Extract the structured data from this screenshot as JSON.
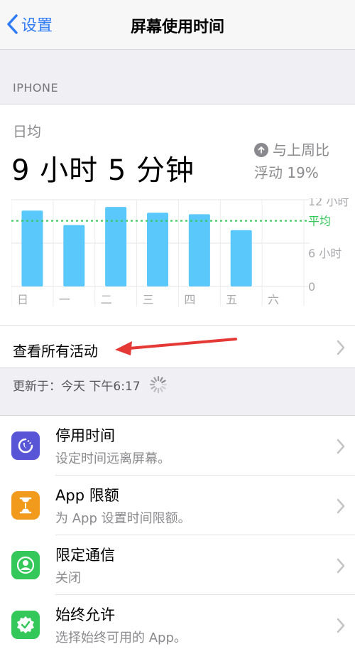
{
  "navbar": {
    "back_label": "设置",
    "title": "屏幕使用时间"
  },
  "section_header": "IPHONE",
  "summary": {
    "daily_label": "日均",
    "daily_value": "9 小时 5 分钟",
    "compare_line1": "与上周比",
    "compare_line2": "浮动 19%"
  },
  "chart_data": {
    "type": "bar",
    "categories": [
      "日",
      "一",
      "二",
      "三",
      "四",
      "五",
      "六"
    ],
    "values": [
      10.5,
      8.5,
      11,
      10.2,
      10,
      7.8,
      0
    ],
    "average": 9.08,
    "average_label": "平均",
    "y_ticks": [
      "12 小时",
      "6 小时",
      "0"
    ],
    "ylim": [
      0,
      12
    ],
    "bar_color": "#5ac8fa",
    "average_color": "#34c759"
  },
  "see_all_label": "查看所有活动",
  "updated": {
    "text": "更新于：今天 下午6:17"
  },
  "rows": [
    {
      "title": "停用时间",
      "subtitle": "设定时间远离屏幕。",
      "icon": "downtime-icon",
      "color": "#5856d6"
    },
    {
      "title": "App 限额",
      "subtitle": "为 App 设置时间限额。",
      "icon": "hourglass-icon",
      "color": "#f19a1c"
    },
    {
      "title": "限定通信",
      "subtitle": "关闭",
      "icon": "contact-icon",
      "color": "#34c759"
    },
    {
      "title": "始终允许",
      "subtitle": "选择始终可用的 App。",
      "icon": "checkmark-badge-icon",
      "color": "#34c759"
    }
  ]
}
